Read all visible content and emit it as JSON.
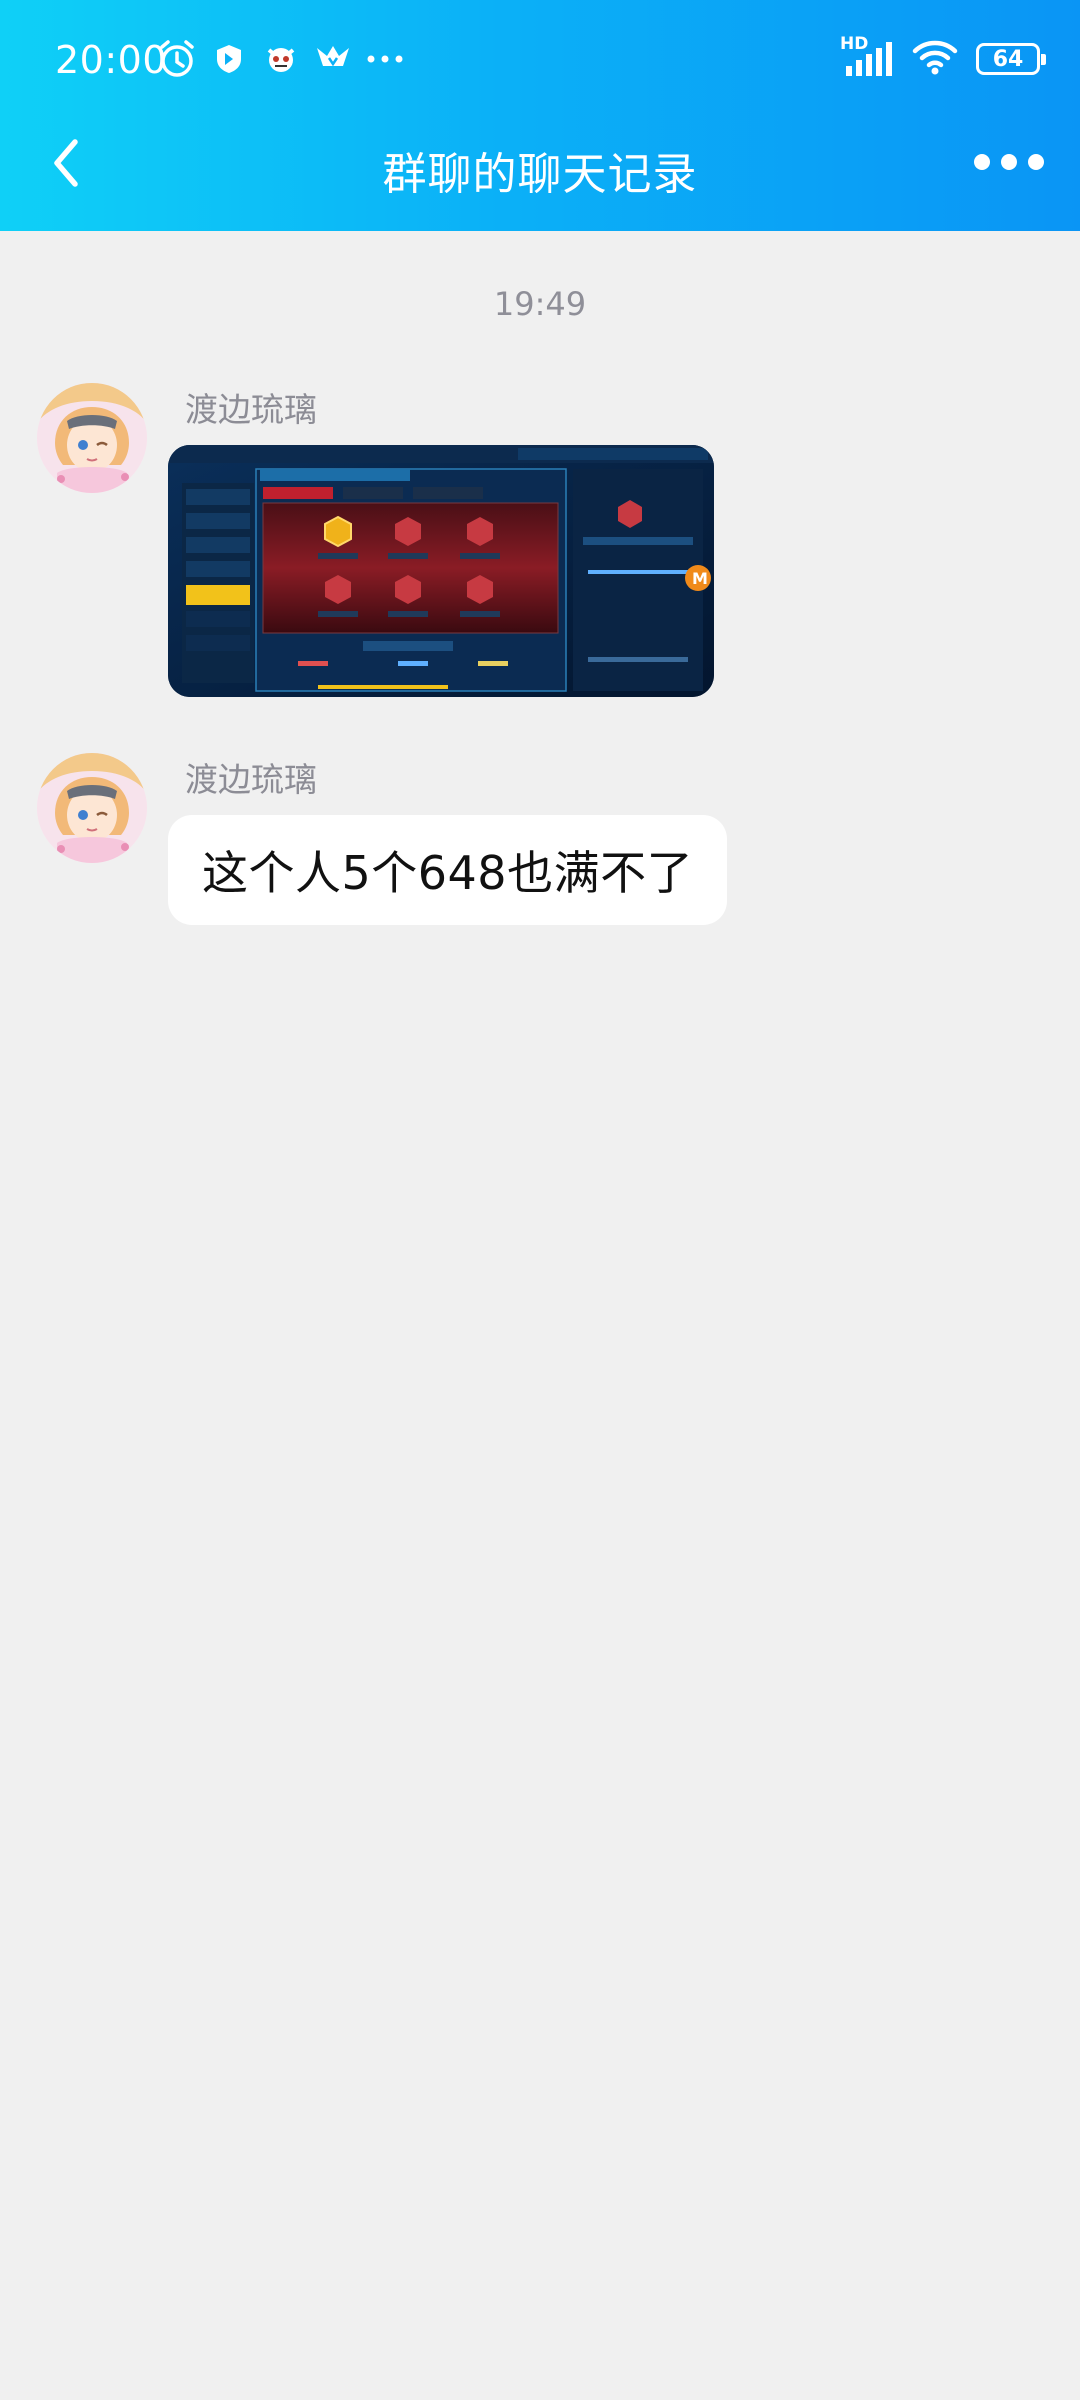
{
  "status_bar": {
    "time": "20:00",
    "battery": "64",
    "network_label": "HD",
    "left_icons": [
      "alarm-icon",
      "shield-app-icon",
      "mascot-app-icon",
      "wing-app-icon",
      "more-notifications-icon"
    ],
    "right_icons": [
      "signal-icon",
      "wifi-icon",
      "battery-icon"
    ]
  },
  "header": {
    "title": "群聊的聊天记录",
    "back_icon": "chevron-left-icon",
    "more_icon": "more-dots-icon",
    "gradient": [
      "#0fd0f7",
      "#0a95f5"
    ]
  },
  "chat": {
    "timestamp": "19:49",
    "messages": [
      {
        "sender": "渡边琉璃",
        "type": "image",
        "content": "game-screenshot"
      },
      {
        "sender": "渡边琉璃",
        "type": "text",
        "content": "这个人5个648也满不了"
      }
    ]
  },
  "colors": {
    "background": "#f0f0f0",
    "bubble": "#ffffff",
    "meta_text": "#8c8c95"
  }
}
